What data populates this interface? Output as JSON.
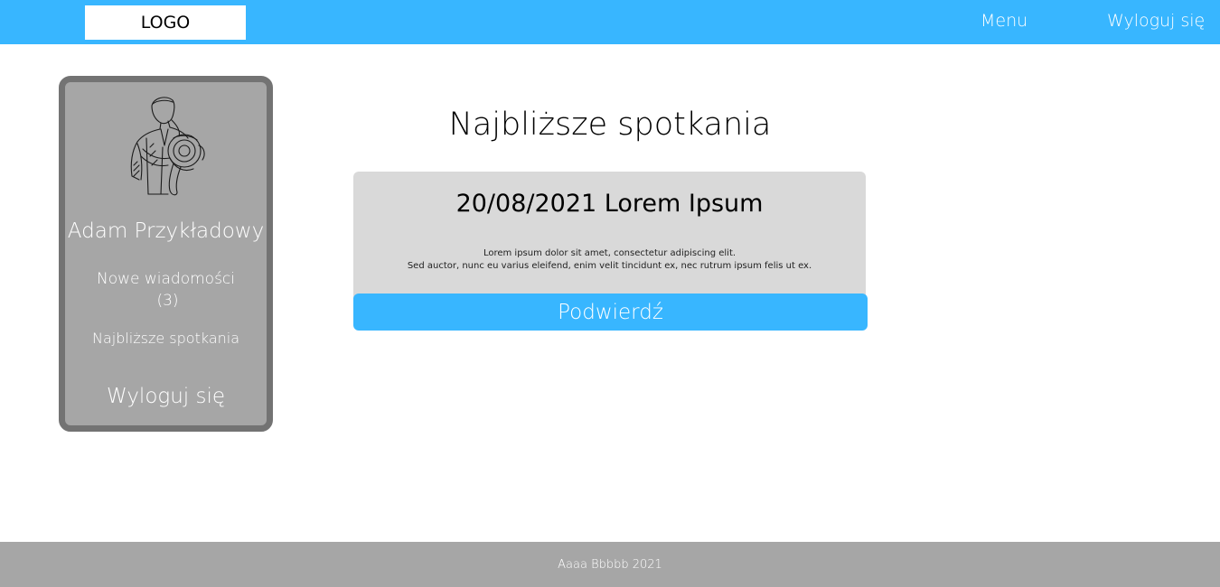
{
  "header": {
    "logo": "LOGO",
    "menu_label": "Menu",
    "logout_label": "Wyloguj się",
    "background": "#38b6ff"
  },
  "sidebar": {
    "avatar_icon": "french-horn-player-illustration",
    "user_name": "Adam Przykładowy",
    "messages_label": "Nowe wiadomości",
    "messages_count": "(3)",
    "meetings_label": "Najbliższe spotkania",
    "logout_label": "Wyloguj się",
    "background": "#a6a6a6",
    "border": "#737373"
  },
  "main": {
    "title": "Najbliższe spotkania",
    "meeting": {
      "title": "20/08/2021 Lorem Ipsum",
      "line1": "Lorem ipsum dolor sit amet, consectetur adipiscing elit.",
      "line2": "Sed auctor, nunc eu varius eleifend, enim velit tincidunt ex, nec rutrum ipsum felis ut ex.",
      "confirm_label": "Podwierdź"
    }
  },
  "footer": {
    "text": "Aaaa Bbbbb 2021"
  }
}
